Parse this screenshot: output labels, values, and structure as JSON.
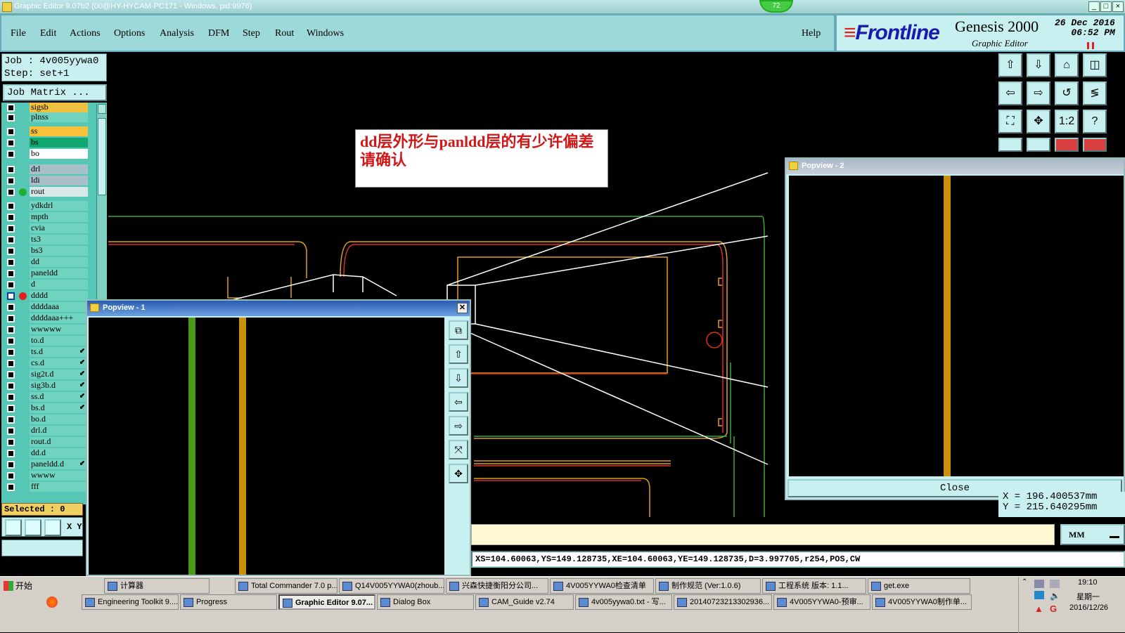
{
  "window": {
    "title": "Graphic Editor 9.07b2 (00@HY-HYCAM-PC171 - Windows, pid:9976)",
    "badge": "72",
    "controls": [
      "_",
      "□",
      "×"
    ]
  },
  "menu": {
    "items": [
      "File",
      "Edit",
      "Actions",
      "Options",
      "Analysis",
      "DFM",
      "Step",
      "Rout",
      "Windows"
    ],
    "help": "Help"
  },
  "brand": {
    "logo": "Frontline",
    "product": "Genesis 2000",
    "subtitle": "Graphic Editor",
    "date": "26 Dec 2016",
    "time": "06:52 PM"
  },
  "job": {
    "job_line": "Job : 4v005yywa0",
    "step_line": "Step: set+1",
    "matrix_button": "Job Matrix ..."
  },
  "layers": [
    {
      "name": "sigsb",
      "bg": "#f0c040"
    },
    {
      "name": "plnss",
      "bg": "#6fd3c0"
    },
    {
      "name": "ss",
      "bg": "#f7c23a"
    },
    {
      "name": "bs",
      "bg": "#11a86f"
    },
    {
      "name": "bo",
      "bg": "#ffffff"
    },
    {
      "name": "drl",
      "bg": "#a9c0c8"
    },
    {
      "name": "ldi",
      "bg": "#a9c0c8"
    },
    {
      "name": "rout",
      "bg": "#d8e8e8",
      "dot": "#20b030"
    },
    {
      "name": "ydkdrl",
      "bg": "#6fd3c0"
    },
    {
      "name": "mpth",
      "bg": "#6fd3c0"
    },
    {
      "name": "cvia",
      "bg": "#6fd3c0"
    },
    {
      "name": "ts3",
      "bg": "#6fd3c0"
    },
    {
      "name": "bs3",
      "bg": "#6fd3c0"
    },
    {
      "name": "dd",
      "bg": "#6fd3c0"
    },
    {
      "name": "paneldd",
      "bg": "#6fd3c0"
    },
    {
      "name": "d",
      "bg": "#6fd3c0"
    },
    {
      "name": "dddd",
      "bg": "#6fd3c0",
      "dot": "#e02020",
      "active": true
    },
    {
      "name": "ddddaaa",
      "bg": "#6fd3c0"
    },
    {
      "name": "ddddaaa+++",
      "bg": "#6fd3c0"
    },
    {
      "name": "wwwww",
      "bg": "#6fd3c0"
    },
    {
      "name": "to.d",
      "bg": "#6fd3c0"
    },
    {
      "name": "ts.d",
      "bg": "#6fd3c0",
      "tick": "⬋"
    },
    {
      "name": "cs.d",
      "bg": "#6fd3c0",
      "tick": "⬋"
    },
    {
      "name": "sig2t.d",
      "bg": "#6fd3c0",
      "tick": "⬋"
    },
    {
      "name": "sig3b.d",
      "bg": "#6fd3c0",
      "tick": "⬋"
    },
    {
      "name": "ss.d",
      "bg": "#6fd3c0",
      "tick": "⬋"
    },
    {
      "name": "bs.d",
      "bg": "#6fd3c0",
      "tick": "⬋"
    },
    {
      "name": "bo.d",
      "bg": "#6fd3c0"
    },
    {
      "name": "drl.d",
      "bg": "#6fd3c0"
    },
    {
      "name": "rout.d",
      "bg": "#6fd3c0"
    },
    {
      "name": "dd.d",
      "bg": "#6fd3c0"
    },
    {
      "name": "paneldd.d",
      "bg": "#6fd3c0",
      "tick": "⬋"
    },
    {
      "name": "wwww",
      "bg": "#6fd3c0"
    },
    {
      "name": "fff",
      "bg": "#6fd3c0"
    }
  ],
  "selected": "Selected : 0",
  "xy_label": "X Y",
  "note": "dd层外形与panldd层的有少许偏差   请确认",
  "popview1": {
    "title": "Popview - 1"
  },
  "popview2": {
    "title": "Popview - 2",
    "close": "Close"
  },
  "coords": {
    "x": "X = 196.400537mm",
    "y": "Y = 215.640295mm"
  },
  "units": "MM",
  "command_line": "XS=104.60063,YS=149.128735,XE=104.60063,YE=149.128735,D=3.997705,r254,POS,CW",
  "taskbar": {
    "start": "开始",
    "row1": [
      {
        "label": "计算器"
      },
      {
        "label": "Total Commander 7.0 p..."
      },
      {
        "label": "Q14V005YYWA0(zhoub..."
      },
      {
        "label": "兴森快捷衡阳分公司..."
      },
      {
        "label": "4V005YYWA0检查清单"
      },
      {
        "label": "制作规范 (Ver:1.0.6)"
      },
      {
        "label": "工程系统  版本: 1.1..."
      },
      {
        "label": "get.exe"
      }
    ],
    "row2": [
      {
        "label": "Engineering Toolkit 9...."
      },
      {
        "label": "Progress"
      },
      {
        "label": "Graphic Editor 9.07...",
        "active": true
      },
      {
        "label": "Dialog Box"
      },
      {
        "label": "CAM_Guide v2.74"
      },
      {
        "label": "4v005yywa0.txt - 写..."
      },
      {
        "label": "20140723213302936..."
      },
      {
        "label": "4V005YYWA0-预审..."
      },
      {
        "label": "4V005YYWA0制作单..."
      }
    ],
    "clock": {
      "time": "19:10",
      "weekday": "星期一",
      "date": "2016/12/26"
    }
  }
}
